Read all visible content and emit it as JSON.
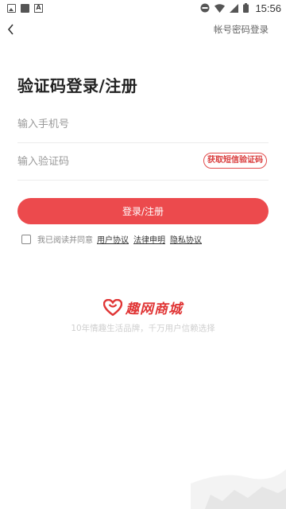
{
  "status_bar": {
    "time": "15:56",
    "left_icons": [
      "image-icon",
      "square-icon",
      "font-icon"
    ],
    "right_icons": [
      "do-not-disturb-icon",
      "wifi-icon",
      "signal-icon",
      "battery-icon"
    ]
  },
  "header": {
    "switch_login_label": "帐号密码登录"
  },
  "page": {
    "title": "验证码登录/注册"
  },
  "form": {
    "phone_placeholder": "输入手机号",
    "phone_value": "",
    "code_placeholder": "输入验证码",
    "code_value": "",
    "sms_button_label": "获取短信验证码",
    "login_button_label": "登录/注册"
  },
  "agreement": {
    "text": "我已阅读并同意",
    "checked": false,
    "links": [
      "用户协议",
      "法律申明",
      "隐私协议"
    ]
  },
  "brand": {
    "name": "趣网商城",
    "slogan": "10年情趣生活品牌，千万用户信赖选择"
  },
  "colors": {
    "accent": "#ec4a4d",
    "brand_red": "#e03535"
  }
}
